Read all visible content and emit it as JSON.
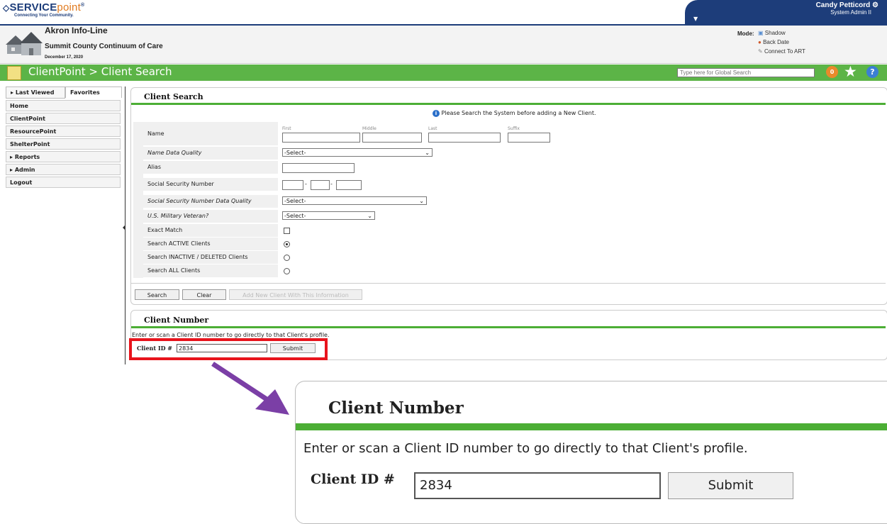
{
  "header": {
    "logo_main": "SERVICE",
    "logo_point": "point",
    "logo_mark": "®",
    "tagline": "Connecting Your Community.",
    "user_name": "Candy Petticord",
    "user_role": "System Admin II",
    "org_name": "Akron Info-Line",
    "coc_name": "Summit County Continuum of Care",
    "date": "December 17, 2020",
    "mode_label": "Mode:",
    "mode_options": [
      "Shadow",
      "Back Date",
      "Connect To ART"
    ]
  },
  "titlebar": {
    "title": "ClientPoint > Client Search",
    "global_search_placeholder": "Type here for Global Search",
    "badge_count": "0"
  },
  "sidebar": {
    "tabs": [
      "Last Viewed",
      "Favorites"
    ],
    "items": [
      "Home",
      "ClientPoint",
      "ResourcePoint",
      "ShelterPoint",
      "Reports",
      "Admin",
      "Logout"
    ]
  },
  "client_search": {
    "title": "Client Search",
    "notice": "Please Search the System before adding a New Client.",
    "fields": {
      "name": "Name",
      "name_sub": [
        "First",
        "Middle",
        "Last",
        "Suffix"
      ],
      "name_dq": "Name Data Quality",
      "alias": "Alias",
      "ssn": "Social Security Number",
      "ssn_dq": "Social Security Number Data Quality",
      "veteran": "U.S. Military Veteran?",
      "exact": "Exact Match",
      "active": "Search ACTIVE Clients",
      "inactive": "Search INACTIVE / DELETED Clients",
      "all": "Search ALL Clients"
    },
    "select_default": "-Select-",
    "ssn_sep": "-",
    "buttons": {
      "search": "Search",
      "clear": "Clear",
      "add_new": "Add New Client With This Information"
    }
  },
  "client_number": {
    "title": "Client Number",
    "instructions": "Enter or scan a Client ID number to go directly to that Client's profile.",
    "id_label": "Client ID #",
    "id_value": "2834",
    "submit": "Submit"
  },
  "colors": {
    "navy": "#1d3d7a",
    "green_bar": "#5cb447",
    "highlight_red": "#e8141c",
    "arrow_purple": "#7b3fa6"
  }
}
